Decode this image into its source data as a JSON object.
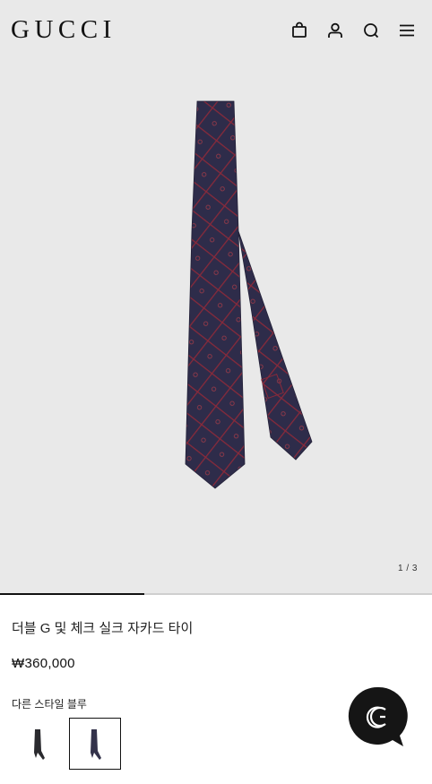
{
  "header": {
    "logo": "GUCCI",
    "icons": [
      "shopping-bag-icon",
      "account-icon",
      "search-icon",
      "menu-icon"
    ]
  },
  "gallery": {
    "counter": "1 / 3",
    "progress": 0.333,
    "background": "#e9e9e9"
  },
  "product": {
    "title": "더블 G 및 체크 실크 자카드 타이",
    "price": "₩360,000",
    "style_label": "다른 스타일 블루"
  },
  "colors": {
    "tie_navy": "#2e2c4a",
    "tie_check": "#8a2a3a",
    "chat_bubble": "#151515"
  },
  "chat": {
    "icon": "gg-chat-icon"
  }
}
